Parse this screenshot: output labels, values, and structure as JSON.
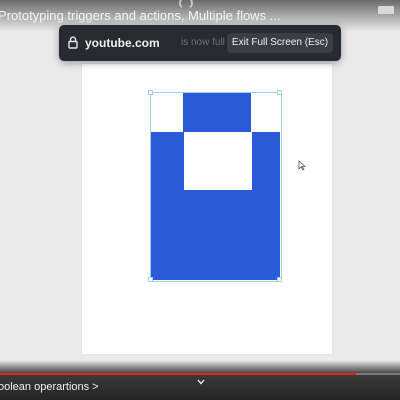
{
  "video": {
    "title": "Prototyping triggers and actions, Multiple flows ...",
    "chapter": "oolean operartions >",
    "progress_fraction": 0.89
  },
  "fullscreen_notice": {
    "domain": "youtube.com",
    "hint": "is now full screen",
    "exit_label": "Exit Full Screen (Esc)"
  },
  "colors": {
    "shape_fill": "#2c5bd8",
    "selection": "#9ed3e8",
    "progress": "#e62117"
  },
  "icons": [
    "lock-icon",
    "cursor-icon",
    "chevron-down-icon",
    "loading-spinner-icon",
    "fullscreen-icon"
  ]
}
